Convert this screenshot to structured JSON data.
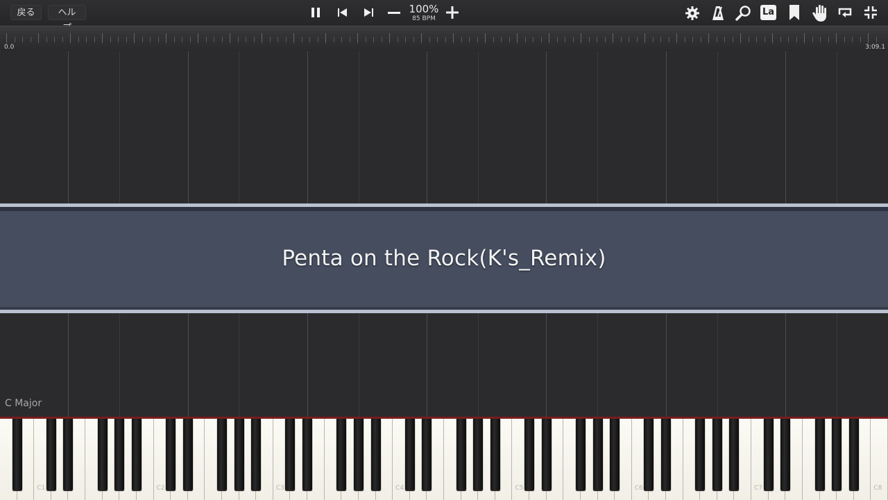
{
  "toolbar": {
    "back_label": "戻る",
    "help_label": "ヘルプ",
    "tempo_percent": "100%",
    "tempo_bpm": "85 BPM",
    "icons": [
      "pause-icon",
      "skip-back-icon",
      "skip-forward-icon",
      "minus-icon",
      "plus-icon",
      "settings-gear-icon",
      "metronome-icon",
      "search-icon",
      "la-label-icon",
      "bookmark-icon",
      "hand-icon",
      "loop-icon",
      "collapse-icon"
    ],
    "la_text": "La"
  },
  "timeline": {
    "start_time": "0.0",
    "end_time": "3:09.1"
  },
  "banner": {
    "title": "Penta on the Rock(K's_Remix)"
  },
  "key_signature": "C Major",
  "keyboard": {
    "octave_labels": [
      "C1",
      "C2",
      "C3",
      "C4",
      "C5",
      "C6",
      "C7",
      "C8"
    ],
    "accent_color": "#7a1d1d"
  },
  "colors": {
    "background": "#2c2c2e",
    "banner": "#454d5f",
    "banner_border": "#b9c1d1"
  }
}
